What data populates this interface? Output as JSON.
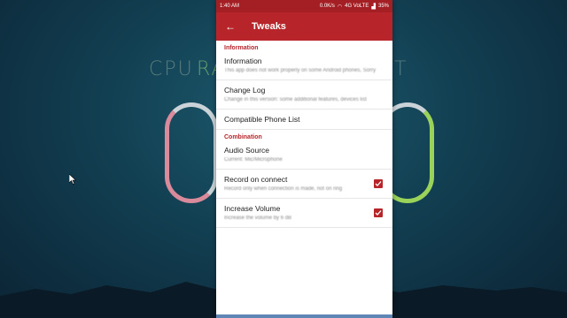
{
  "background": {
    "words": [
      "CPU",
      "RA",
      "T"
    ]
  },
  "status_bar": {
    "time": "1:40 AM",
    "speed": "0.0K/s",
    "network": "4G VoLTE",
    "battery": "35%"
  },
  "app_bar": {
    "title": "Tweaks",
    "back_icon": "arrow-back-icon"
  },
  "sections": [
    {
      "header": "Information",
      "items": [
        {
          "title": "Information",
          "summary": "This app does not work properly on some Android phones, Sorry",
          "checkbox": false
        },
        {
          "title": "Change Log",
          "summary": "Change in this version: some additional features, devices list",
          "checkbox": false
        },
        {
          "title": "Compatible Phone List",
          "summary": "",
          "checkbox": false
        }
      ]
    },
    {
      "header": "Combination",
      "items": [
        {
          "title": "Audio Source",
          "summary": "Current: Mic/Microphone",
          "checkbox": false
        },
        {
          "title": "Record on connect",
          "summary": "Record only when connection is made, not on ring",
          "checkbox": true
        },
        {
          "title": "Increase Volume",
          "summary": "Increase the volume by 6 dB",
          "checkbox": true
        }
      ]
    }
  ],
  "colors": {
    "accent": "#b7252b",
    "status_bar": "#a41f24"
  }
}
